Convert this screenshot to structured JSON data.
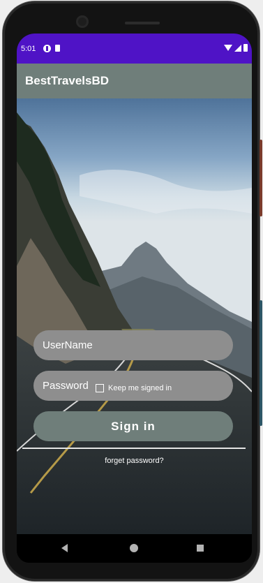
{
  "status_bar": {
    "time": "5:01"
  },
  "app_bar": {
    "title": "BestTravelsBD"
  },
  "login_form": {
    "username_placeholder": "UserName",
    "password_placeholder": "Password",
    "keep_signed_in_label": "Keep me signed in",
    "sign_in_label": "Sign in",
    "forget_password_label": "forget password?"
  },
  "colors": {
    "status_bar": "#4F13C6",
    "app_bar": "#6F7E7A",
    "input_fill": "#8E8E8E",
    "button_fill": "#6F7E7A"
  },
  "icons": {
    "status_left": [
      "do-not-disturb-icon",
      "sim-card-icon"
    ],
    "status_right": [
      "wifi-icon",
      "signal-icon",
      "battery-icon"
    ],
    "nav": [
      "back-icon",
      "home-icon",
      "recents-icon"
    ]
  }
}
